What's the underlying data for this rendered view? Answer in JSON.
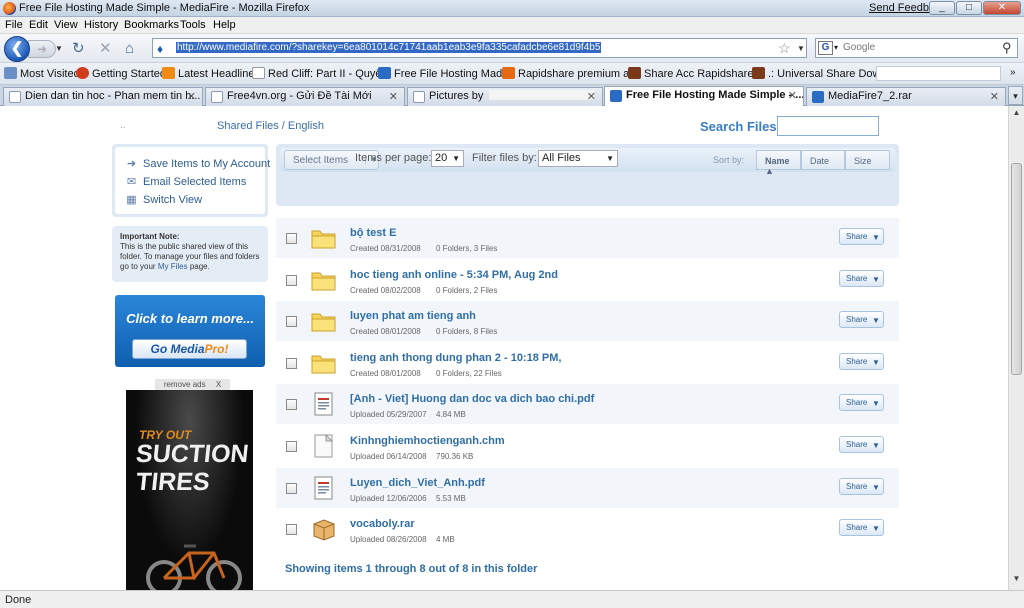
{
  "window": {
    "title": "Free File Hosting Made Simple - MediaFire - Mozilla Firefox",
    "send_feedback": "Send Feedback",
    "minimize": "_",
    "maximize": "□",
    "close": "✕"
  },
  "menu": [
    "File",
    "Edit",
    "View",
    "History",
    "Bookmarks",
    "Tools",
    "Help"
  ],
  "nav": {
    "url": "http://www.mediafire.com/?sharekey=6ea801014c71741aab1eab3e9fa335cafadcbe6e81d9f4b5",
    "search_placeholder": "Google",
    "search_engine_letter": "G"
  },
  "bookmarks": [
    "Most Visited",
    "Getting Started",
    "Latest Headlines",
    "Red Cliff: Part II - Quyế...",
    "Free File Hosting Mad...",
    "Rapidshare premium a...",
    "Share Acc Rapidshare ...",
    ".: Universal Share Dow..."
  ],
  "tabs": [
    "Dien dan tin hoc - Phan mem tin h...",
    "Free4vn.org - Gửi Đề Tài Mới",
    "Pictures by",
    "Free File Hosting Made Simple - ...",
    "MediaFire7_2.rar"
  ],
  "page": {
    "breadcrumb": "Shared Files / English",
    "search_files_label": "Search Files:",
    "actions": [
      "Save Items to My Account",
      "Email Selected Items",
      "Switch View"
    ],
    "note": {
      "title": "Important Note:",
      "text": "This is the public shared view of this folder. To manage your files and folders go to your",
      "link": "My Files",
      "end": "page."
    },
    "promo": {
      "headline": "Click to learn more...",
      "button_prefix": "Go Media",
      "button_suffix": "Pro!"
    },
    "remove_ads": "remove ads",
    "ad": {
      "line1": "TRY OUT",
      "line2": "SUCTION",
      "line3": "TIRES"
    },
    "toolbar": {
      "select_items": "Select Items",
      "sort_by": "Sort by:",
      "sort_name": "Name",
      "sort_date": "Date",
      "sort_size": "Size",
      "items_per_page_label": "Items per page:",
      "items_per_page": "20",
      "filter_label": "Filter files by:",
      "filter_value": "All Files"
    },
    "share_label": "Share",
    "files": [
      {
        "name": "bộ test E",
        "date": "Created 08/31/2008",
        "info": "0 Folders, 3 Files",
        "type": "folder"
      },
      {
        "name": "hoc tieng anh online - 5:34 PM, Aug 2nd",
        "date": "Created 08/02/2008",
        "info": "0 Folders, 2 Files",
        "type": "folder"
      },
      {
        "name": "luyen phat am tieng anh",
        "date": "Created 08/01/2008",
        "info": "0 Folders, 8 Files",
        "type": "folder"
      },
      {
        "name": "tieng anh thong dung phan 2 - 10:18 PM,",
        "date": "Created 08/01/2008",
        "info": "0 Folders, 22 Files",
        "type": "folder"
      },
      {
        "name": "[Anh - Viet] Huong dan doc va dich bao chi.pdf",
        "date": "Uploaded 05/29/2007",
        "info": "4.84 MB",
        "type": "pdf"
      },
      {
        "name": "Kinhnghiemhoctienganh.chm",
        "date": "Uploaded 06/14/2008",
        "info": "790.36 KB",
        "type": "chm"
      },
      {
        "name": "Luyen_dich_Viet_Anh.pdf",
        "date": "Uploaded 12/06/2006",
        "info": "5.53 MB",
        "type": "pdf"
      },
      {
        "name": "vocaboly.rar",
        "date": "Uploaded 08/26/2008",
        "info": "4 MB",
        "type": "rar"
      }
    ],
    "footer": "Showing items 1 through 8 out of 8 in this folder"
  },
  "status": "Done"
}
